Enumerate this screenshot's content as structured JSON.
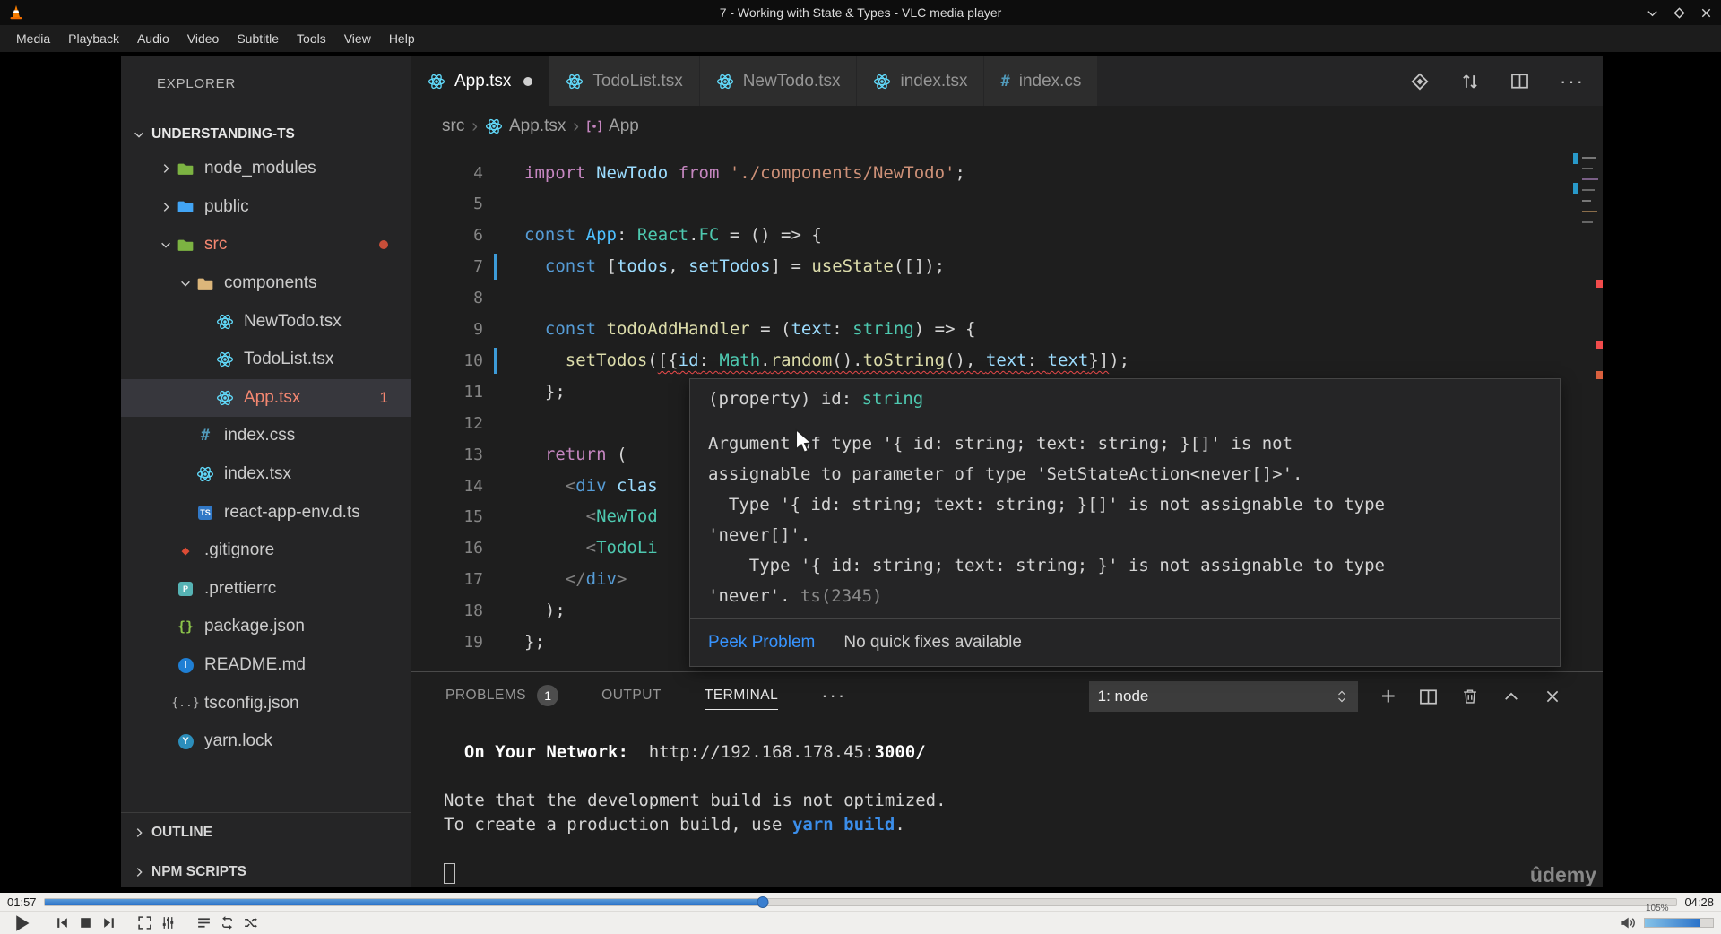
{
  "vlc": {
    "title": "7 - Working with State & Types - VLC media player",
    "menu": [
      "Media",
      "Playback",
      "Audio",
      "Video",
      "Subtitle",
      "Tools",
      "View",
      "Help"
    ],
    "window_buttons": [
      "minimize",
      "maximize",
      "close"
    ],
    "time_elapsed": "01:57",
    "time_total": "04:28",
    "progress_pct": 44,
    "volume_label": "105%",
    "volume_fill_pct": 82,
    "transport_icons": [
      "play",
      "previous",
      "stop",
      "next",
      "fullscreen",
      "extended-settings",
      "playlist",
      "loop",
      "random"
    ]
  },
  "vscode": {
    "watermark": "ûdemy",
    "explorer": {
      "title": "EXPLORER",
      "root": "UNDERSTANDING-TS",
      "tree": [
        {
          "label": "node_modules",
          "icon": "folder",
          "iconColor": "#7cb342",
          "chevron": "collapsed",
          "indent": 1
        },
        {
          "label": "public",
          "icon": "folder",
          "iconColor": "#42a5f5",
          "chevron": "collapsed",
          "indent": 1
        },
        {
          "label": "src",
          "icon": "folder",
          "iconColor": "#7cb342",
          "chevron": "expanded",
          "indent": 1,
          "labelColor": "#f48771",
          "modifiedDot": true
        },
        {
          "label": "components",
          "icon": "folder",
          "iconColor": "#dcb67a",
          "chevron": "expanded",
          "indent": 2
        },
        {
          "label": "NewTodo.tsx",
          "icon": "react",
          "indent": 3
        },
        {
          "label": "TodoList.tsx",
          "icon": "react",
          "indent": 3
        },
        {
          "label": "App.tsx",
          "icon": "react",
          "indent": 3,
          "selected": true,
          "labelColor": "#f48771",
          "badge": "1"
        },
        {
          "label": "index.css",
          "icon": "css",
          "indent": 2
        },
        {
          "label": "index.tsx",
          "icon": "react",
          "indent": 2
        },
        {
          "label": "react-app-env.d.ts",
          "icon": "ts",
          "indent": 2
        },
        {
          "label": ".gitignore",
          "icon": "git",
          "indent": 1
        },
        {
          "label": ".prettierrc",
          "icon": "prettier",
          "indent": 1
        },
        {
          "label": "package.json",
          "icon": "npm",
          "indent": 1
        },
        {
          "label": "README.md",
          "icon": "info",
          "indent": 1
        },
        {
          "label": "tsconfig.json",
          "icon": "braces",
          "indent": 1
        },
        {
          "label": "yarn.lock",
          "icon": "yarn",
          "indent": 1
        }
      ],
      "sections": [
        "OUTLINE",
        "NPM SCRIPTS"
      ]
    },
    "tabs": [
      {
        "label": "App.tsx",
        "icon": "react",
        "active": true,
        "modified": true
      },
      {
        "label": "TodoList.tsx",
        "icon": "react"
      },
      {
        "label": "NewTodo.tsx",
        "icon": "react"
      },
      {
        "label": "index.tsx",
        "icon": "react"
      },
      {
        "label": "index.cs",
        "icon": "css",
        "truncated": true
      }
    ],
    "editor_toolbar_icons": [
      "open-changes",
      "compare-changes",
      "split-editor",
      "more-actions"
    ],
    "breadcrumb": [
      {
        "label": "src"
      },
      {
        "label": "App.tsx",
        "icon": "react"
      },
      {
        "label": "App",
        "icon": "symbol"
      }
    ],
    "code_lines": [
      {
        "n": "4",
        "seg": [
          [
            "import",
            "kw2"
          ],
          [
            " ",
            "fg"
          ],
          [
            "NewTodo",
            "var"
          ],
          [
            " ",
            "fg"
          ],
          [
            "from",
            "kw2"
          ],
          [
            " ",
            "fg"
          ],
          [
            "'./components/NewTodo'",
            "str"
          ],
          [
            ";",
            "fg"
          ]
        ]
      },
      {
        "n": "5",
        "seg": []
      },
      {
        "n": "6",
        "seg": [
          [
            "const",
            "kw"
          ],
          [
            " ",
            "fg"
          ],
          [
            "App",
            "cvar"
          ],
          [
            ": ",
            "fg"
          ],
          [
            "React",
            "type"
          ],
          [
            ".",
            "fg"
          ],
          [
            "FC",
            "type"
          ],
          [
            " = () => {",
            "fg"
          ]
        ]
      },
      {
        "n": "7",
        "gutter": true,
        "seg": [
          [
            "  ",
            "fg"
          ],
          [
            "const",
            "kw"
          ],
          [
            " [",
            "fg"
          ],
          [
            "todos",
            "var"
          ],
          [
            ", ",
            "fg"
          ],
          [
            "setTodos",
            "var"
          ],
          [
            "] = ",
            "fg"
          ],
          [
            "useState",
            "fn"
          ],
          [
            "([]);",
            "fg"
          ]
        ]
      },
      {
        "n": "8",
        "seg": []
      },
      {
        "n": "9",
        "seg": [
          [
            "  ",
            "fg"
          ],
          [
            "const",
            "kw"
          ],
          [
            " ",
            "fg"
          ],
          [
            "todoAddHandler",
            "fn"
          ],
          [
            " = (",
            "fg"
          ],
          [
            "text",
            "var"
          ],
          [
            ": ",
            "fg"
          ],
          [
            "string",
            "type"
          ],
          [
            ") => {",
            "fg"
          ]
        ]
      },
      {
        "n": "10",
        "gutter": true,
        "seg": [
          [
            "    ",
            "fg"
          ],
          [
            "setTodos",
            "fn"
          ],
          [
            "(",
            "fg"
          ],
          [
            "[{",
            "fg",
            "sq"
          ],
          [
            "id",
            "var",
            "sq"
          ],
          [
            ": ",
            "fg",
            "sq"
          ],
          [
            "Math",
            "type",
            "sq"
          ],
          [
            ".",
            "fg",
            "sq"
          ],
          [
            "random",
            "fn",
            "sq"
          ],
          [
            "().",
            "fg",
            "sq"
          ],
          [
            "toString",
            "fn",
            "sq"
          ],
          [
            "(), ",
            "fg",
            "sq"
          ],
          [
            "text",
            "var",
            "sq"
          ],
          [
            ": ",
            "fg",
            "sq"
          ],
          [
            "text",
            "var",
            "sq"
          ],
          [
            "}]",
            "fg",
            "sq"
          ],
          [
            ");",
            "fg"
          ]
        ]
      },
      {
        "n": "11",
        "seg": [
          [
            "  };",
            "fg"
          ]
        ]
      },
      {
        "n": "12",
        "seg": []
      },
      {
        "n": "13",
        "seg": [
          [
            "  ",
            "fg"
          ],
          [
            "return",
            "kw2"
          ],
          [
            " (",
            "fg"
          ]
        ]
      },
      {
        "n": "14",
        "seg": [
          [
            "    ",
            "fg"
          ],
          [
            "<",
            "gray"
          ],
          [
            "div",
            "kw"
          ],
          [
            " clas",
            "var"
          ]
        ]
      },
      {
        "n": "15",
        "seg": [
          [
            "      ",
            "fg"
          ],
          [
            "<",
            "gray"
          ],
          [
            "NewTod",
            "type"
          ]
        ]
      },
      {
        "n": "16",
        "seg": [
          [
            "      ",
            "fg"
          ],
          [
            "<",
            "gray"
          ],
          [
            "TodoLi",
            "type"
          ]
        ]
      },
      {
        "n": "17",
        "seg": [
          [
            "    ",
            "fg"
          ],
          [
            "</",
            "gray"
          ],
          [
            "div",
            "kw"
          ],
          [
            ">",
            "gray"
          ]
        ]
      },
      {
        "n": "18",
        "seg": [
          [
            "  );",
            "fg"
          ]
        ]
      },
      {
        "n": "19",
        "seg": [
          [
            "};",
            "fg"
          ]
        ]
      }
    ],
    "tooltip": {
      "header_segments": [
        [
          "(property) id: ",
          "fg"
        ],
        [
          "string",
          "type"
        ]
      ],
      "body_lines": [
        [
          [
            "Argument of type '{ id: string; text: string; }[]' is not",
            "fg"
          ]
        ],
        [
          [
            "assignable to parameter of type 'SetStateAction<never[]>'.",
            "fg"
          ]
        ],
        [
          [
            "  Type '{ id: string; text: string; }[]' is not assignable to type",
            "fg"
          ]
        ],
        [
          [
            "'never[]'.",
            "fg"
          ]
        ],
        [
          [
            "    Type '{ id: string; text: string; }' is not assignable to type",
            "fg"
          ]
        ],
        [
          [
            "'never'. ",
            "fg"
          ],
          [
            "ts(2345)",
            "dim"
          ]
        ]
      ],
      "peek_label": "Peek Problem",
      "no_fix_label": "No quick fixes available"
    },
    "panel": {
      "tabs": [
        {
          "label": "PROBLEMS",
          "badge": "1"
        },
        {
          "label": "OUTPUT"
        },
        {
          "label": "TERMINAL",
          "active": true
        }
      ],
      "dropdown_value": "1: node",
      "action_icons": [
        "new-terminal",
        "split-terminal",
        "kill-terminal",
        "maximize-panel",
        "close-panel"
      ],
      "terminal_lines": [
        [
          [
            "  ",
            "fg"
          ],
          [
            "On Your Network:",
            "bold"
          ],
          [
            "  http://192.168.178.45:",
            "fg"
          ],
          [
            "3000/",
            "bold"
          ]
        ],
        [],
        [
          [
            "Note that the development build is not optimized.",
            "fg"
          ]
        ],
        [
          [
            "To create a production build, use ",
            "fg"
          ],
          [
            "yarn build",
            "link"
          ],
          [
            ".",
            "fg"
          ]
        ],
        []
      ],
      "cursor": true
    }
  },
  "colors": {
    "accent_blue": "#3794ff",
    "error_red": "#f48771",
    "squiggle_red": "#f14c4c",
    "modified_blue": "#3d9bd8",
    "seek_blue": "#2a72c9",
    "react_blue": "#61dafb"
  }
}
